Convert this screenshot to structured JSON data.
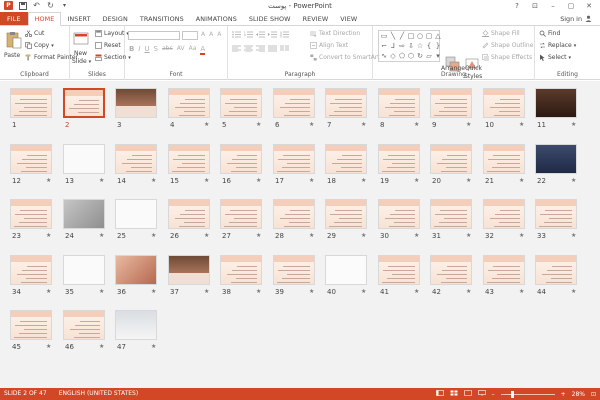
{
  "window": {
    "title": "پوست - PowerPoint",
    "min": "–",
    "restore": "▢",
    "close": "✕",
    "help": "?",
    "options": "⊡"
  },
  "qat": {
    "app_glyph": "P",
    "save": "💾",
    "undo": "↶",
    "redo": "↻",
    "customize": "▾"
  },
  "tabs": [
    "FILE",
    "HOME",
    "INSERT",
    "DESIGN",
    "TRANSITIONS",
    "ANIMATIONS",
    "SLIDE SHOW",
    "REVIEW",
    "VIEW"
  ],
  "signin": "Sign in",
  "ribbon": {
    "clipboard": {
      "paste": "Paste",
      "cut": "Cut",
      "copy": "Copy",
      "format_painter": "Format Painter",
      "label": "Clipboard"
    },
    "slides": {
      "new_slide_1": "New",
      "new_slide_2": "Slide",
      "layout": "Layout",
      "reset": "Reset",
      "section": "Section",
      "label": "Slides"
    },
    "font": {
      "label": "Font",
      "grow": "A",
      "shrink": "A",
      "clear": "A",
      "bold": "B",
      "italic": "I",
      "underline": "U",
      "shadow": "S",
      "strike": "abc",
      "spacing": "AV",
      "case": "Aa",
      "color": "A"
    },
    "paragraph": {
      "text_direction": "Text Direction",
      "align_text": "Align Text",
      "convert": "Convert to SmartArt",
      "label": "Paragraph"
    },
    "drawing": {
      "arrange": "Arrange",
      "quick_1": "Quick",
      "quick_2": "Styles",
      "shape_fill": "Shape Fill",
      "shape_outline": "Shape Outline",
      "shape_effects": "Shape Effects",
      "label": "Drawing"
    },
    "editing": {
      "find": "Find",
      "replace": "Replace",
      "select": "Select",
      "label": "Editing"
    }
  },
  "slide_numbers": [
    "1",
    "2",
    "3",
    "4",
    "5",
    "6",
    "7",
    "8",
    "9",
    "10",
    "11",
    "12",
    "13",
    "14",
    "15",
    "16",
    "17",
    "18",
    "19",
    "20",
    "21",
    "22",
    "23",
    "24",
    "25",
    "26",
    "27",
    "28",
    "29",
    "30",
    "31",
    "32",
    "33",
    "34",
    "35",
    "36",
    "37",
    "38",
    "39",
    "40",
    "41",
    "42",
    "43",
    "44",
    "45",
    "46",
    "47"
  ],
  "transition_star": "★",
  "selected_slide": 2,
  "status": {
    "slide": "SLIDE 2 OF 47",
    "language": "ENGLISH (UNITED STATES)",
    "zoom": "28%",
    "minus": "–",
    "plus": "+",
    "fit": "⊡"
  },
  "colors": {
    "accent": "#d24726",
    "sorter_bg": "#f2f2f2"
  }
}
